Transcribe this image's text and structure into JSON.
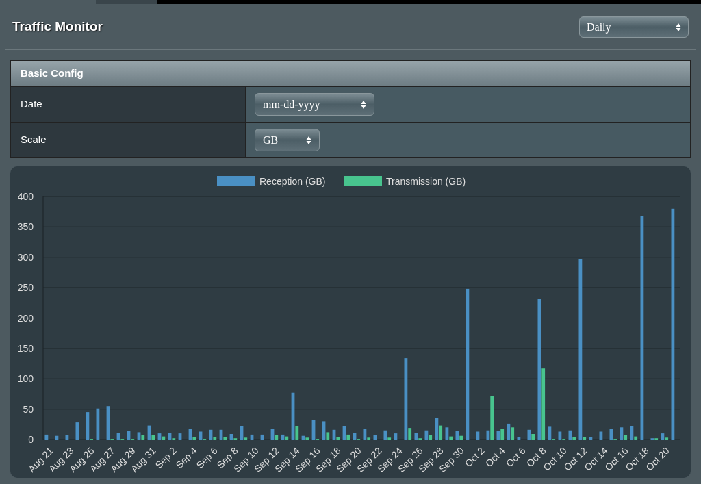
{
  "title": "Traffic Monitor",
  "period_select": {
    "value": "Daily"
  },
  "config": {
    "header": "Basic Config",
    "rows": [
      {
        "label": "Date",
        "value": "mm-dd-yyyy"
      },
      {
        "label": "Scale",
        "value": "GB"
      }
    ]
  },
  "chart_data": {
    "type": "bar",
    "grid": true,
    "legend": true,
    "stacked": false,
    "categories": [
      "Aug 21",
      null,
      "Aug 23",
      null,
      "Aug 25",
      null,
      "Aug 27",
      null,
      "Aug 29",
      null,
      "Aug 31",
      null,
      "Sep 2",
      null,
      "Sep 4",
      null,
      "Sep 6",
      null,
      "Sep 8",
      null,
      "Sep 10",
      null,
      "Sep 12",
      null,
      "Sep 14",
      null,
      "Sep 16",
      null,
      "Sep 18",
      null,
      "Sep 20",
      null,
      "Sep 22",
      null,
      "Sep 24",
      null,
      "Sep 26",
      null,
      "Sep 28",
      null,
      "Sep 30",
      null,
      "Oct 2",
      null,
      "Oct 4",
      null,
      "Oct 6",
      null,
      "Oct 8",
      null,
      "Oct 10",
      null,
      "Oct 12",
      null,
      "Oct 14",
      null,
      "Oct 16",
      null,
      "Oct 18",
      null,
      "Oct 20",
      null
    ],
    "series": [
      {
        "name": "Reception (GB)",
        "color": "#4a90c4",
        "values": [
          8,
          6,
          7,
          28,
          45,
          51,
          55,
          11,
          14,
          12,
          23,
          10,
          11,
          10,
          18,
          13,
          16,
          16,
          9,
          22,
          8,
          8,
          17,
          8,
          77,
          6,
          32,
          30,
          16,
          22,
          11,
          17,
          7,
          15,
          10,
          134,
          11,
          15,
          36,
          20,
          14,
          248,
          13,
          15,
          14,
          26,
          4,
          16,
          231,
          21,
          13,
          15,
          297,
          4,
          13,
          17,
          20,
          22,
          368,
          2,
          10,
          380
        ]
      },
      {
        "name": "Transmission (GB)",
        "color": "#48c48e",
        "values": [
          0,
          0,
          0,
          0,
          1,
          0,
          1,
          1,
          1,
          7,
          7,
          5,
          2,
          0,
          4,
          1,
          4,
          4,
          2,
          3,
          0,
          0,
          7,
          5,
          22,
          3,
          1,
          12,
          4,
          8,
          1,
          3,
          0,
          3,
          0,
          19,
          2,
          7,
          23,
          5,
          6,
          0,
          0,
          72,
          17,
          20,
          0,
          9,
          117,
          1,
          1,
          4,
          4,
          0,
          0,
          1,
          7,
          5,
          0,
          2,
          3,
          0
        ]
      }
    ],
    "ylim": [
      0,
      400
    ],
    "yticks": [
      0,
      50,
      100,
      150,
      200,
      250,
      300,
      350,
      400
    ]
  }
}
